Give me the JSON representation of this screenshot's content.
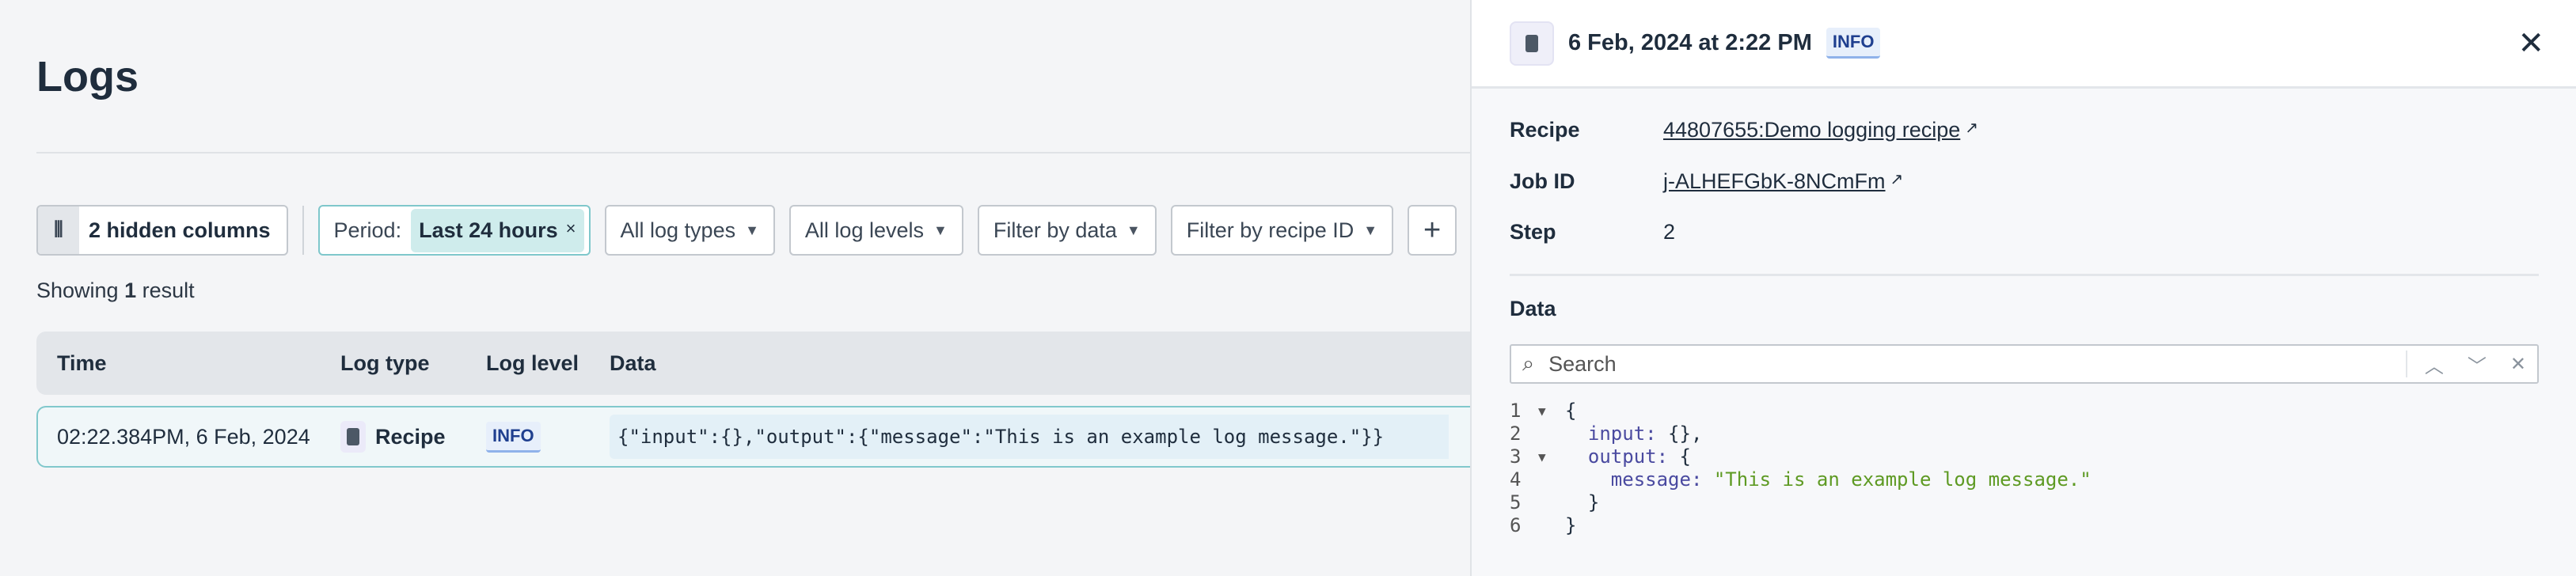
{
  "page": {
    "title": "Logs"
  },
  "toolbar": {
    "hidden_columns": "2 hidden columns",
    "period_label": "Period:",
    "period_value": "Last 24 hours",
    "log_types": "All log types",
    "log_levels": "All log levels",
    "filter_data": "Filter by data",
    "filter_recipe": "Filter by recipe ID"
  },
  "summary": {
    "prefix": "Showing ",
    "count": "1",
    "suffix": " result"
  },
  "table": {
    "columns": [
      "Time",
      "Log type",
      "Log level",
      "Data"
    ],
    "rows": [
      {
        "time": "02:22.384PM, 6 Feb, 2024",
        "log_type": "Recipe",
        "log_level": "INFO",
        "data": "{\"input\":{},\"output\":{\"message\":\"This is an example log message.\"}}"
      }
    ]
  },
  "panel": {
    "title": "6 Feb, 2024 at 2:22 PM",
    "level": "INFO",
    "fields": [
      {
        "label": "Recipe",
        "value": "44807655:Demo logging recipe"
      },
      {
        "label": "Job ID",
        "value": "j-ALHEFGbK-8NCmFm"
      },
      {
        "label": "Step",
        "value": "2"
      }
    ],
    "data_label": "Data",
    "search_placeholder": "Search",
    "code": [
      {
        "n": "1",
        "fold": true,
        "indent": "",
        "text": "{"
      },
      {
        "n": "2",
        "fold": false,
        "indent": "  ",
        "key": "input",
        "text": " {},"
      },
      {
        "n": "3",
        "fold": true,
        "indent": "  ",
        "key": "output",
        "text": " {"
      },
      {
        "n": "4",
        "fold": false,
        "indent": "    ",
        "key": "message",
        "str": "\"This is an example log message.\""
      },
      {
        "n": "5",
        "fold": false,
        "indent": "  ",
        "text": "}"
      },
      {
        "n": "6",
        "fold": false,
        "indent": "",
        "text": "}"
      }
    ]
  },
  "colors": {
    "accent": "#81c8cc",
    "info_badge": "#1f3f8f",
    "json_key": "#4a4aa0",
    "json_string": "#5e9a23"
  }
}
